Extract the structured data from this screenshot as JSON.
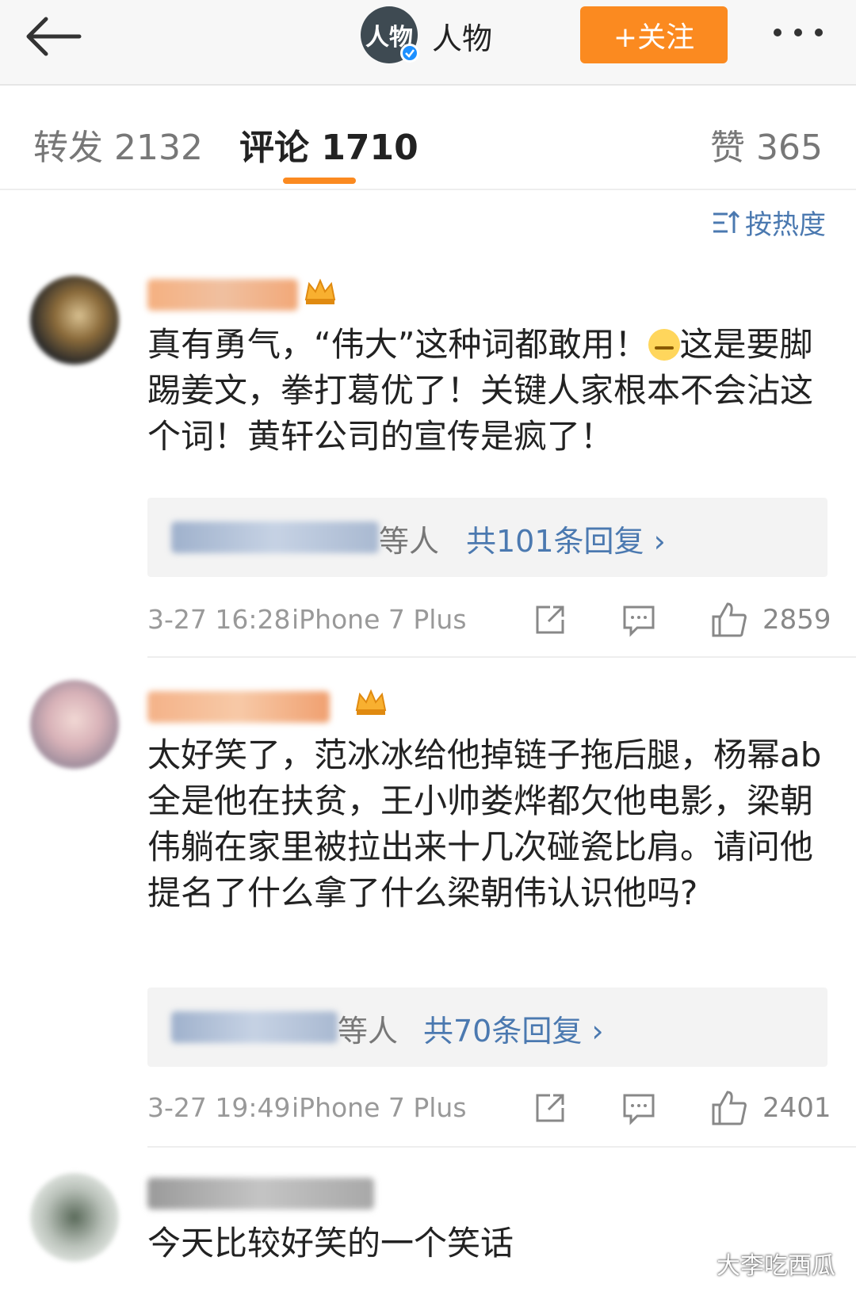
{
  "header": {
    "account_logo_text": "人物",
    "account_name": "人物",
    "follow_label": "+关注"
  },
  "tabs": [
    {
      "label": "转发 2132"
    },
    {
      "label": "评论 1710"
    },
    {
      "label": "赞 365"
    }
  ],
  "sort": {
    "label": "按热度"
  },
  "comments": [
    {
      "text": "真有勇气，“伟大”这种词都敢用！",
      "text_after_emoji": "这是要脚踢姜文，拳打葛优了！关键人家根本不会沾这个词！黄轩公司的宣传是疯了！",
      "reply_suffix": "等人",
      "reply_count": "共101条回复 ›",
      "time": "3-27 16:28",
      "device": "iPhone 7 Plus",
      "likes": "2859"
    },
    {
      "text": "太好笑了，范冰冰给他掉链子拖后腿，杨幂ab全是他在扶贫，王小帅娄烨都欠他电影，梁朝伟躺在家里被拉出来十几次碰瓷比肩。请问他提名了什么拿了什么梁朝伟认识他吗?",
      "reply_suffix": "等人",
      "reply_count": "共70条回复 ›",
      "time": "3-27 19:49",
      "device": "iPhone 7 Plus",
      "likes": "2401"
    },
    {
      "text": "今天比较好笑的一个笑话"
    }
  ],
  "watermark": {
    "text": "大李吃西瓜"
  },
  "colors": {
    "accent": "#fb8a20",
    "link": "#4b79b0"
  }
}
